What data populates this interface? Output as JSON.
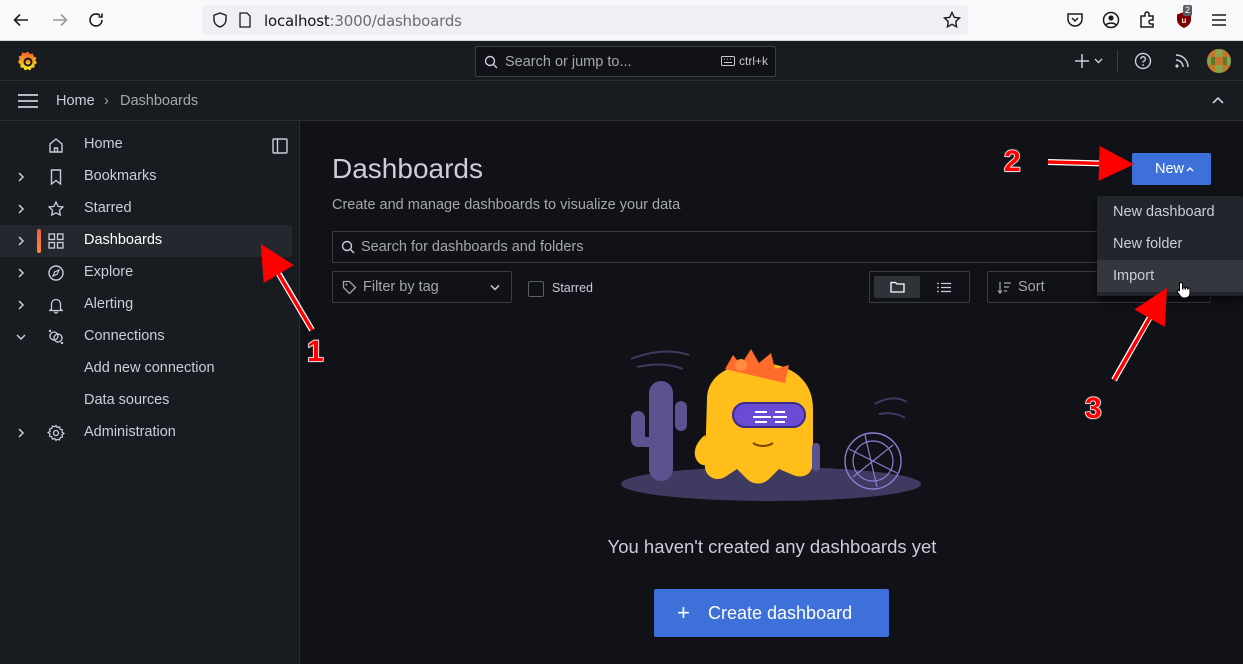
{
  "browser": {
    "url_host": "localhost",
    "url_path": ":3000/dashboards",
    "ext_badge": "2"
  },
  "topbar": {
    "search_placeholder": "Search or jump to...",
    "shortcut": "ctrl+k",
    "add_label": "+"
  },
  "breadcrumb": {
    "home": "Home",
    "separator": "›",
    "current": "Dashboards"
  },
  "sidebar": {
    "items": [
      {
        "label": "Home",
        "icon": "home-icon",
        "chevron": false
      },
      {
        "label": "Bookmarks",
        "icon": "bookmark-icon",
        "chevron": true
      },
      {
        "label": "Starred",
        "icon": "star-icon",
        "chevron": true
      },
      {
        "label": "Dashboards",
        "icon": "apps-icon",
        "chevron": true,
        "active": true
      },
      {
        "label": "Explore",
        "icon": "compass-icon",
        "chevron": true
      },
      {
        "label": "Alerting",
        "icon": "bell-icon",
        "chevron": true
      },
      {
        "label": "Connections",
        "icon": "connections-icon",
        "chevron": true,
        "expanded": true
      },
      {
        "label": "Add new connection",
        "sub": true
      },
      {
        "label": "Data sources",
        "sub": true
      },
      {
        "label": "Administration",
        "icon": "cog-icon",
        "chevron": true
      }
    ]
  },
  "main": {
    "title": "Dashboards",
    "subtitle": "Create and manage dashboards to visualize your data",
    "new_button": "New",
    "search_placeholder": "Search for dashboards and folders",
    "filter_tag": "Filter by tag",
    "starred_label": "Starred",
    "sort_label": "Sort",
    "empty_text": "You haven't created any dashboards yet",
    "create_button": "Create dashboard"
  },
  "new_menu": {
    "items": [
      "New dashboard",
      "New folder",
      "Import"
    ],
    "hovered": "Import"
  },
  "annotations": {
    "step1": "1",
    "step2": "2",
    "step3": "3"
  },
  "colors": {
    "primary": "#3d71d9",
    "active_accent": "#f55f3e",
    "annotation": "#ff0000"
  }
}
